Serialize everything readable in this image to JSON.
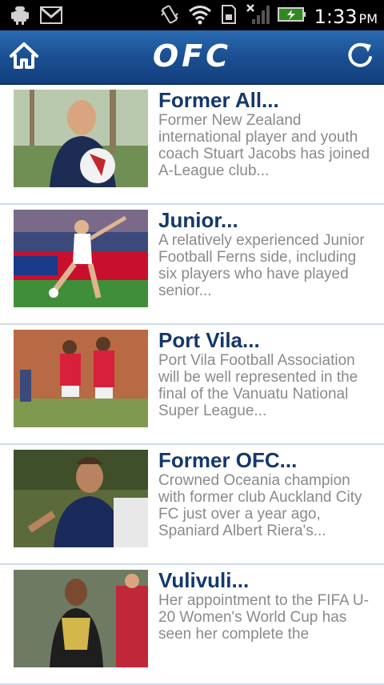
{
  "status_bar": {
    "time": "1:33",
    "ampm": "PM",
    "icons": [
      "android-debug-icon",
      "gmail-icon",
      "vibrate-icon",
      "wifi-icon",
      "sd-card-icon",
      "no-signal-icon",
      "battery-charging-icon"
    ]
  },
  "header": {
    "logo_text": "OFC",
    "colors": {
      "bar_top": "#2a6bb3",
      "bar_bottom": "#123f7e"
    }
  },
  "news": [
    {
      "title": "Former All...",
      "summary": "Former New Zealand international player and youth coach Stuart Jacobs has joined A-League club...",
      "thumbnail": "coach-with-ball-photo"
    },
    {
      "title": "Junior...",
      "summary": "A relatively experienced Junior Football Ferns side, including six players who have played senior...",
      "thumbnail": "womens-player-kicking-photo"
    },
    {
      "title": "Port Vila...",
      "summary": "Port Vila Football Association will be well represented in the final of the Vanuatu National Super League...",
      "thumbnail": "players-in-red-photo"
    },
    {
      "title": "Former OFC...",
      "summary": "Crowned Oceania champion with former club Auckland City FC just over a year ago, Spaniard Albert Riera's...",
      "thumbnail": "player-in-blue-photo"
    },
    {
      "title": "Vulivuli...",
      "summary": "Her appointment to the FIFA U-20 Women's World Cup has seen her complete the",
      "thumbnail": "referee-photo"
    }
  ]
}
